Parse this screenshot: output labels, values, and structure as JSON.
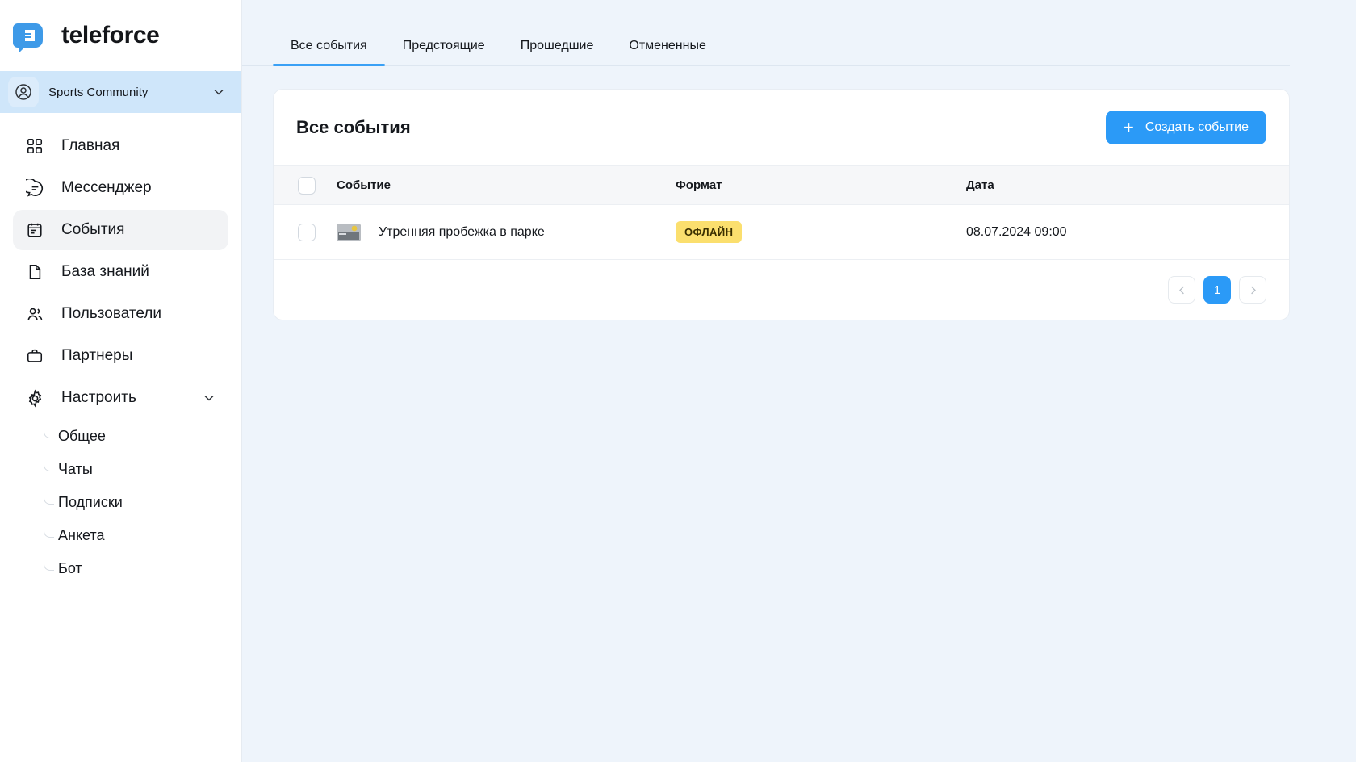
{
  "brand": {
    "name": "teleforce",
    "logo_icon": "teleforce-logo-icon",
    "accent": "#2b9af7"
  },
  "sidebar": {
    "account": {
      "name": "Sports Community",
      "avatar_icon": "user-circle-icon",
      "chevron_icon": "chevron-down-icon"
    },
    "items": [
      {
        "label": "Главная",
        "icon": "grid-icon",
        "active": false
      },
      {
        "label": "Мессенджер",
        "icon": "chat-bubble-icon",
        "active": false
      },
      {
        "label": "События",
        "icon": "calendar-icon",
        "active": true
      },
      {
        "label": "База знаний",
        "icon": "document-icon",
        "active": false
      },
      {
        "label": "Пользователи",
        "icon": "users-icon",
        "active": false
      },
      {
        "label": "Партнеры",
        "icon": "briefcase-icon",
        "active": false
      },
      {
        "label": "Настроить",
        "icon": "gear-icon",
        "active": false,
        "chevron_icon": "chevron-down-icon"
      }
    ],
    "submenu": [
      {
        "label": "Общее"
      },
      {
        "label": "Чаты"
      },
      {
        "label": "Подписки"
      },
      {
        "label": "Анкета"
      },
      {
        "label": "Бот"
      }
    ]
  },
  "tabs": [
    {
      "label": "Все события",
      "active": true
    },
    {
      "label": "Предстоящие",
      "active": false
    },
    {
      "label": "Прошедшие",
      "active": false
    },
    {
      "label": "Отмененные",
      "active": false
    }
  ],
  "card": {
    "title": "Все события",
    "create_button": {
      "label": "Создать событие",
      "icon": "plus-icon"
    }
  },
  "table": {
    "columns": [
      "Событие",
      "Формат",
      "Дата"
    ],
    "rows": [
      {
        "event": "Утренняя пробежка в парке",
        "thumb_icon": "event-thumbnail-image",
        "format": "ОФЛАЙН",
        "format_color": "#fbdf6e",
        "date": "08.07.2024 09:00"
      }
    ]
  },
  "pagination": {
    "prev_icon": "chevron-left-icon",
    "next_icon": "chevron-right-icon",
    "pages": [
      "1"
    ],
    "current": "1"
  }
}
